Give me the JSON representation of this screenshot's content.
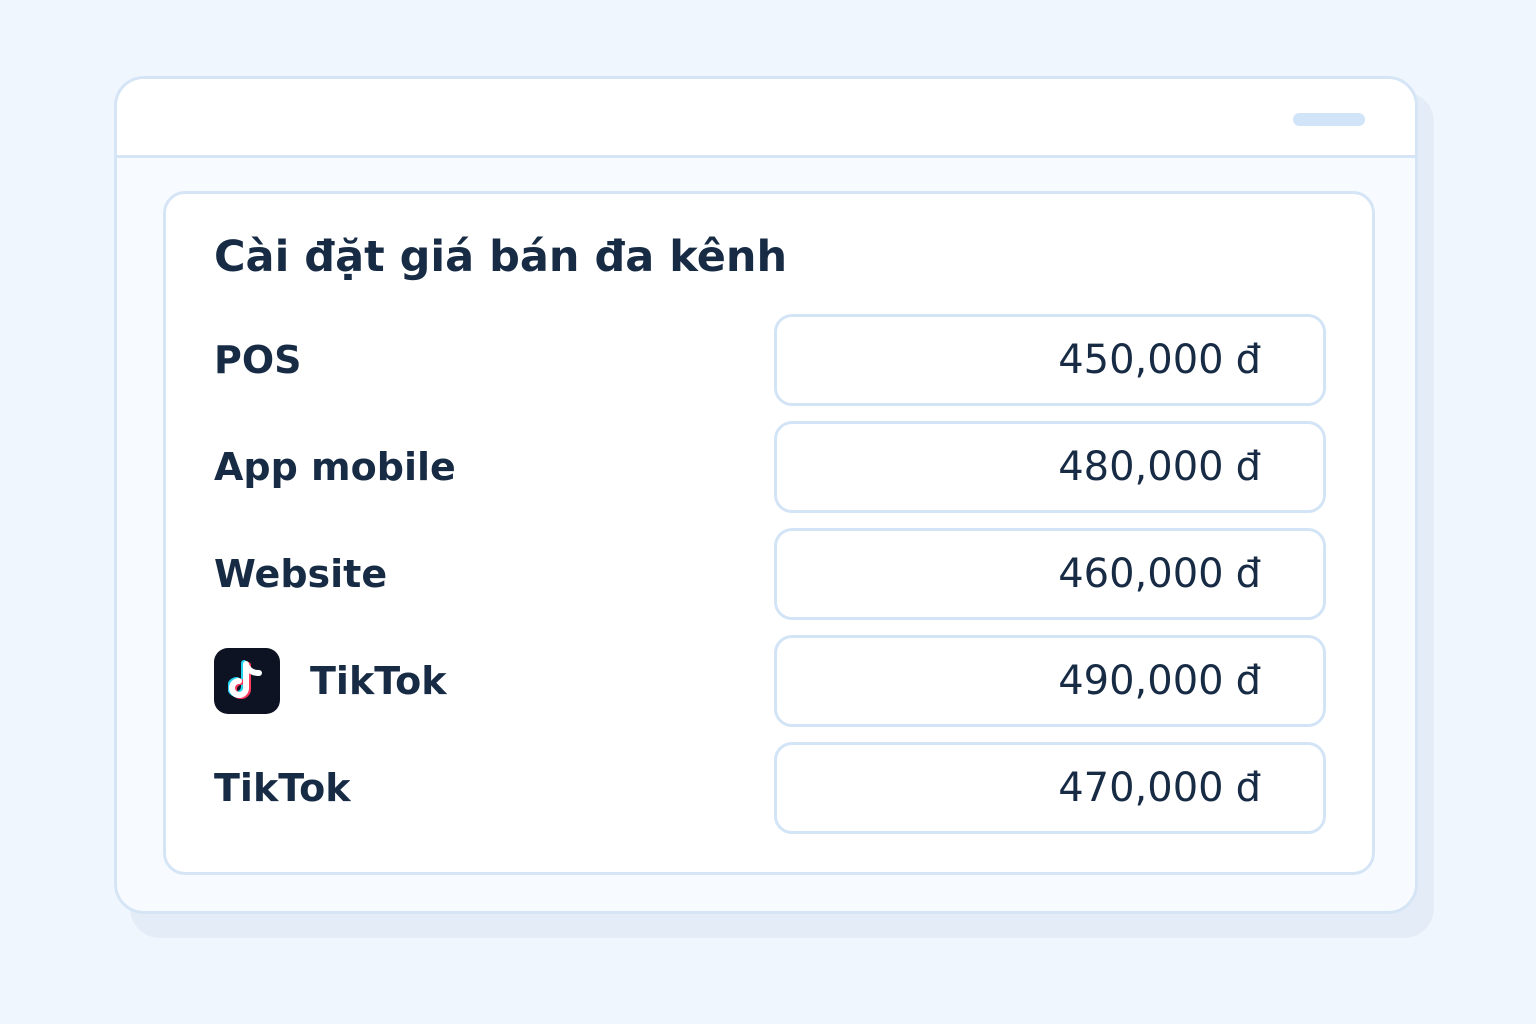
{
  "page": {
    "title": "Cài đặt giá bán đa kênh"
  },
  "channels": [
    {
      "label": "POS",
      "price": "450,000",
      "currency": "đ"
    },
    {
      "label": "App mobile",
      "price": "480,000",
      "currency": "đ"
    },
    {
      "label": "Website",
      "price": "460,000",
      "currency": "đ"
    },
    {
      "label": "TikTok",
      "price": "490,000",
      "currency": "đ",
      "icon": "tiktok-logo-icon"
    },
    {
      "label": "TikTok",
      "price": "470,000",
      "currency": "đ"
    }
  ],
  "colors": {
    "background": "#eff6fd",
    "border": "#d5e5f6",
    "text": "#172b45",
    "icon_background": "#0d1322"
  }
}
